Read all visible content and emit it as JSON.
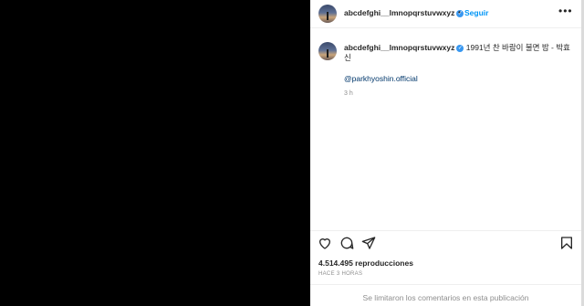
{
  "post": {
    "username": "abcdefghi__lmnopqrstuvwxyz",
    "follow_label": "Seguir",
    "caption_text": "1991년 찬 바람이 불면 밤 - 박효신",
    "mention": "@parkhyoshin.official",
    "time_ago": "3 h",
    "views": "4.514.495 reproducciones",
    "date": "HACE 3 HORAS",
    "comments_disabled": "Se limitaron los comentarios en esta publicación"
  },
  "icons": [
    "heart-icon",
    "comment-icon",
    "share-icon",
    "save-icon",
    "verified-icon",
    "more-icon"
  ],
  "colors": {
    "accent": "#0095f6",
    "verified": "#3897f0",
    "text": "#262626",
    "muted": "#8e8e8e"
  }
}
